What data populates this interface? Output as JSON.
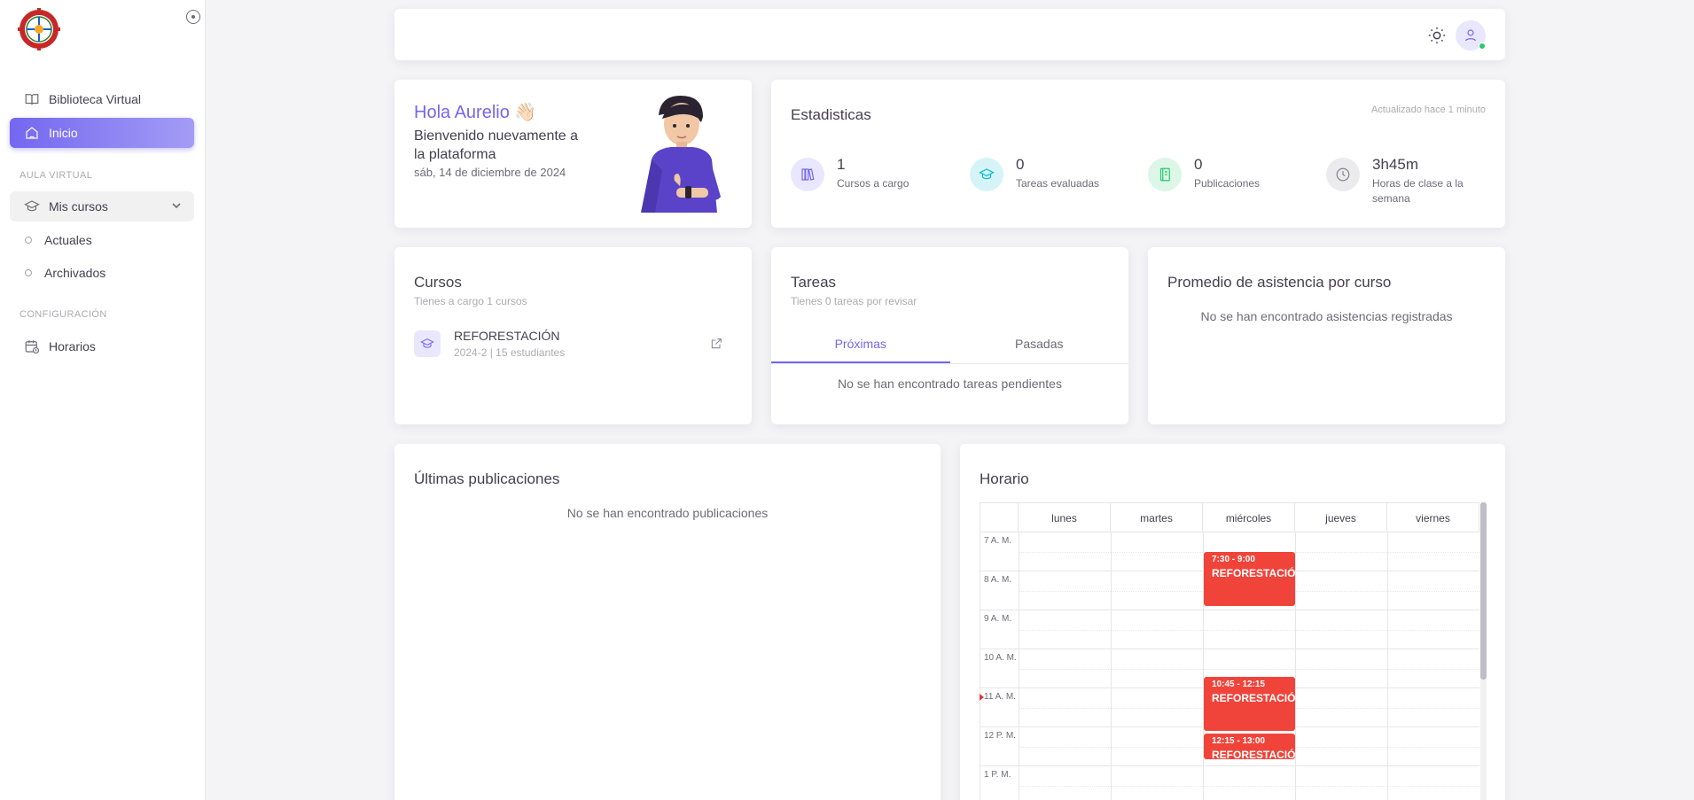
{
  "sidebar": {
    "logo_icon": "institution-seal-logo",
    "items": [
      {
        "label": "Biblioteca Virtual",
        "icon": "book-icon"
      },
      {
        "label": "Inicio",
        "icon": "home-icon"
      }
    ],
    "sections": {
      "aula": "AULA VIRTUAL",
      "config": "CONFIGURACIÓN"
    },
    "courses_menu": {
      "label": "Mis cursos",
      "icon": "graduation-cap-icon"
    },
    "sub_items": [
      "Actuales",
      "Archivados"
    ],
    "schedule_item": {
      "label": "Horarios",
      "icon": "calendar-icon"
    }
  },
  "topbar": {
    "theme_icon": "sun-icon",
    "avatar_icon": "user-icon"
  },
  "welcome": {
    "greeting": "Hola Aurelio 👋🏻",
    "message": "Bienvenido nuevamente a la plataforma",
    "date": "sáb, 14 de diciembre de 2024"
  },
  "stats": {
    "title": "Estadisticas",
    "updated": "Actualizado hace 1 minuto",
    "items": [
      {
        "value": "1",
        "label": "Cursos a cargo",
        "icon": "books-icon",
        "color": "#7367f0",
        "bg": "#e9e7fd"
      },
      {
        "value": "0",
        "label": "Tareas evaluadas",
        "icon": "graduation-cap-icon",
        "color": "#00bad1",
        "bg": "#d6f4f8"
      },
      {
        "value": "0",
        "label": "Publicaciones",
        "icon": "notebook-icon",
        "color": "#28c76f",
        "bg": "#dcf6e8"
      },
      {
        "value": "3h45m",
        "label": "Horas de clase a la semana",
        "icon": "clock-icon",
        "color": "#808390",
        "bg": "#ebebed"
      }
    ]
  },
  "courses": {
    "title": "Cursos",
    "subtitle": "Tienes a cargo 1 cursos",
    "list": [
      {
        "name": "REFORESTACIÓN",
        "meta": "2024-2 | 15 estudiantes"
      }
    ]
  },
  "tasks": {
    "title": "Tareas",
    "subtitle": "Tienes 0 tareas por revisar",
    "tabs": [
      "Próximas",
      "Pasadas"
    ],
    "empty": "No se han encontrado tareas pendientes"
  },
  "attendance": {
    "title": "Promedio de asistencia por curso",
    "empty": "No se han encontrado asistencias registradas"
  },
  "publications": {
    "title": "Últimas publicaciones",
    "empty": "No se han encontrado publicaciones"
  },
  "schedule": {
    "title": "Horario",
    "days": [
      "lunes",
      "martes",
      "miércoles",
      "jueves",
      "viernes"
    ],
    "hours": [
      "7 A. M.",
      "8 A. M.",
      "9 A. M.",
      "10 A. M.",
      "11 A. M.",
      "12 P. M.",
      "1 P. M."
    ],
    "events": [
      {
        "time": "7:30 - 9:00",
        "name": "REFORESTACIÓN",
        "color": "#f0443b"
      },
      {
        "time": "10:45 - 12:15",
        "name": "REFORESTACIÓN",
        "color": "#f0443b"
      },
      {
        "time": "12:15 - 13:00",
        "name": "REFORESTACIÓN",
        "color": "#f0443b"
      }
    ]
  }
}
